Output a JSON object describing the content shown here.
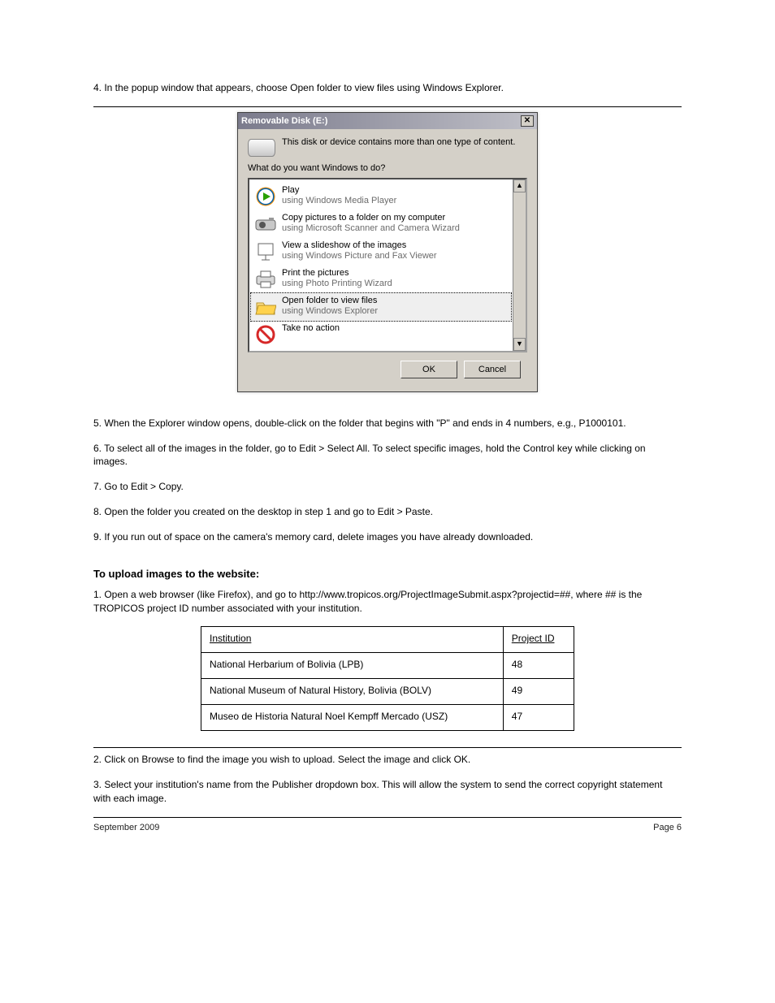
{
  "section_pre": "4. In the popup window that appears, choose Open folder to view files using Windows Explorer.",
  "dialog": {
    "title": "Removable Disk (E:)",
    "intro": "This disk or device contains more than one type of content.",
    "prompt": "What do you want Windows to do?",
    "items": [
      {
        "title": "Play",
        "sub": "using Windows Media Player"
      },
      {
        "title": "Copy pictures to a folder on my computer",
        "sub": "using Microsoft Scanner and Camera Wizard"
      },
      {
        "title": "View a slideshow of the images",
        "sub": "using Windows Picture and Fax Viewer"
      },
      {
        "title": "Print the pictures",
        "sub": "using Photo Printing Wizard"
      },
      {
        "title": "Open folder to view files",
        "sub": "using Windows Explorer",
        "selected": true
      },
      {
        "title": "Take no action",
        "sub": ""
      }
    ],
    "ok": "OK",
    "cancel": "Cancel"
  },
  "after_dialog": [
    "5. When the Explorer window opens, double-click on the folder that begins with \"P\" and ends in 4 numbers, e.g., P1000101.",
    "6. To select all of the images in the folder, go to Edit > Select All. To select specific images, hold the Control key while clicking on images.",
    "7. Go to Edit > Copy.",
    "8. Open the folder you created on the desktop in step 1 and go to Edit > Paste.",
    "9. If you run out of space on the camera's memory card, delete images you have already downloaded."
  ],
  "section2": {
    "heading": "To upload images to the website:",
    "p1": "1. Open a web browser (like Firefox), and go to http://www.tropicos.org/ProjectImageSubmit.aspx?projectid=##, where ## is the TROPICOS project ID number associated with your institution.",
    "table": {
      "headers": [
        "Institution",
        "Project ID"
      ],
      "rows": [
        [
          "National Herbarium of Bolivia (LPB)",
          "48"
        ],
        [
          "National Museum of Natural History, Bolivia (BOLV)",
          "49"
        ],
        [
          "Museo de Historia Natural Noel Kempff Mercado (USZ)",
          "47"
        ]
      ]
    },
    "p2": "2. Click on Browse to find the image you wish to upload. Select the image and click OK.",
    "p3": "3. Select your institution's name from the Publisher dropdown box. This will allow the system to send the correct copyright statement with each image."
  },
  "footer": {
    "date": "September 2009",
    "page": "Page 6"
  }
}
